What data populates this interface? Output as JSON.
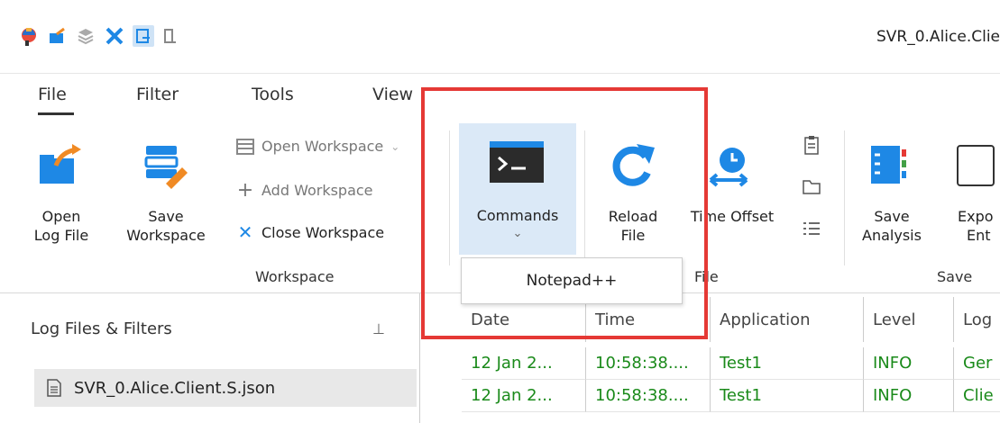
{
  "window": {
    "title": "SVR_0.Alice.Clie"
  },
  "menu": {
    "tabs": [
      "File",
      "Filter",
      "Tools",
      "View"
    ]
  },
  "ribbon": {
    "open_log_file": {
      "line1": "Open",
      "line2": "Log File"
    },
    "save_workspace": {
      "line1": "Save",
      "line2": "Workspace"
    },
    "open_workspace": "Open Workspace",
    "add_workspace": "Add Workspace",
    "close_workspace": "Close Workspace",
    "workspace_group": "Workspace",
    "commands": "Commands",
    "reload_file": {
      "line1": "Reload",
      "line2": "File"
    },
    "time_offset": "Time Offset",
    "file_group": "File",
    "save_analysis": {
      "line1": "Save",
      "line2": "Analysis"
    },
    "export": {
      "line1": "Expo",
      "line2": "Ent"
    },
    "save_group": "Save"
  },
  "dropdown": {
    "item": "Notepad++"
  },
  "left_panel": {
    "title": "Log Files & Filters",
    "file": "SVR_0.Alice.Client.S.json"
  },
  "grid": {
    "columns": [
      "Date",
      "Time",
      "Application",
      "Level",
      "Log"
    ],
    "rows": [
      [
        "12 Jan 2...",
        "10:58:38....",
        "Test1",
        "INFO",
        "Ger"
      ],
      [
        "12 Jan 2...",
        "10:58:38....",
        "Test1",
        "INFO",
        "Clie"
      ]
    ]
  },
  "colors": {
    "highlight": "#e53935",
    "accent": "#1e88e5",
    "row_text": "#1a8a1a",
    "selected": "#dbe9f7"
  }
}
